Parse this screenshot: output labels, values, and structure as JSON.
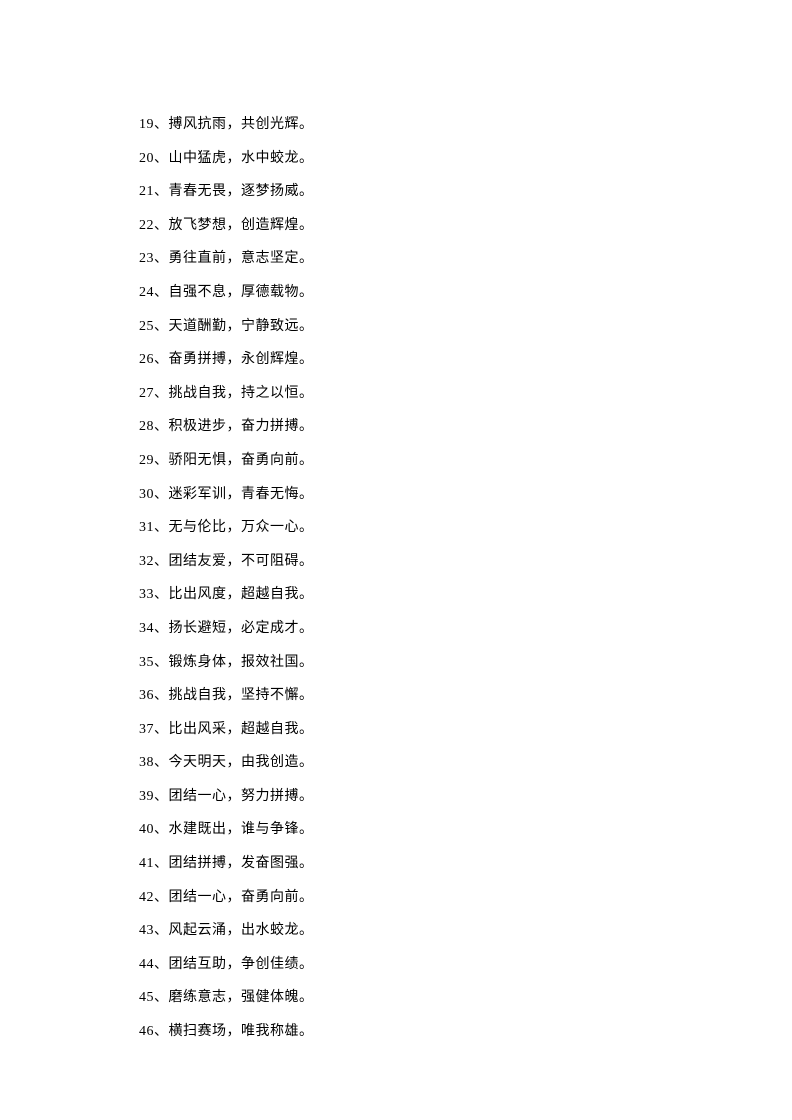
{
  "items": [
    {
      "num": "19",
      "text": "搏风抗雨，共创光辉。"
    },
    {
      "num": "20",
      "text": "山中猛虎，水中蛟龙。"
    },
    {
      "num": "21",
      "text": "青春无畏，逐梦扬威。"
    },
    {
      "num": "22",
      "text": "放飞梦想，创造辉煌。"
    },
    {
      "num": "23",
      "text": "勇往直前，意志坚定。"
    },
    {
      "num": "24",
      "text": "自强不息，厚德载物。"
    },
    {
      "num": "25",
      "text": "天道酬勤，宁静致远。"
    },
    {
      "num": "26",
      "text": "奋勇拼搏，永创辉煌。"
    },
    {
      "num": "27",
      "text": "挑战自我，持之以恒。"
    },
    {
      "num": "28",
      "text": "积极进步，奋力拼搏。"
    },
    {
      "num": "29",
      "text": "骄阳无惧，奋勇向前。"
    },
    {
      "num": "30",
      "text": "迷彩军训，青春无悔。"
    },
    {
      "num": "31",
      "text": "无与伦比，万众一心。"
    },
    {
      "num": "32",
      "text": "团结友爱，不可阻碍。"
    },
    {
      "num": "33",
      "text": "比出风度，超越自我。"
    },
    {
      "num": "34",
      "text": "扬长避短，必定成才。"
    },
    {
      "num": "35",
      "text": "锻炼身体，报效社国。"
    },
    {
      "num": "36",
      "text": "挑战自我，坚持不懈。"
    },
    {
      "num": "37",
      "text": "比出风采，超越自我。"
    },
    {
      "num": "38",
      "text": "今天明天，由我创造。"
    },
    {
      "num": "39",
      "text": "团结一心，努力拼搏。"
    },
    {
      "num": "40",
      "text": "水建既出，谁与争锋。"
    },
    {
      "num": "41",
      "text": "团结拼搏，发奋图强。"
    },
    {
      "num": "42",
      "text": "团结一心，奋勇向前。"
    },
    {
      "num": "43",
      "text": "风起云涌，出水蛟龙。"
    },
    {
      "num": "44",
      "text": "团结互助，争创佳绩。"
    },
    {
      "num": "45",
      "text": "磨练意志，强健体魄。"
    },
    {
      "num": "46",
      "text": "横扫赛场，唯我称雄。"
    }
  ]
}
